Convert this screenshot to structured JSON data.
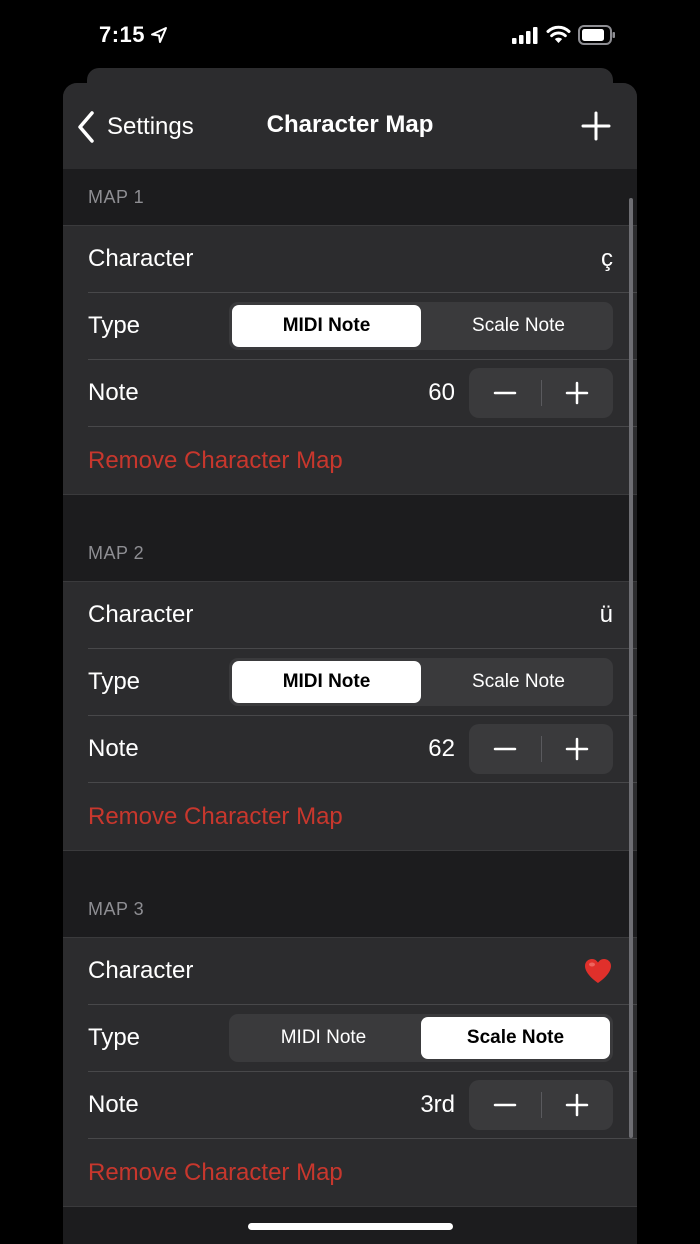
{
  "status": {
    "time": "7:15"
  },
  "nav": {
    "back_label": "Settings",
    "title": "Character Map"
  },
  "maps": [
    {
      "header": "MAP 1",
      "character_label": "Character",
      "character": "ç",
      "type_label": "Type",
      "segments": [
        "MIDI Note",
        "Scale Note"
      ],
      "selected_segment": "MIDI Note",
      "note_label": "Note",
      "note_value": "60",
      "remove_label": "Remove Character Map"
    },
    {
      "header": "MAP 2",
      "character_label": "Character",
      "character": "ü",
      "type_label": "Type",
      "segments": [
        "MIDI Note",
        "Scale Note"
      ],
      "selected_segment": "MIDI Note",
      "note_label": "Note",
      "note_value": "62",
      "remove_label": "Remove Character Map"
    },
    {
      "header": "MAP 3",
      "character_label": "Character",
      "character_icon": "heart-icon",
      "type_label": "Type",
      "segments": [
        "MIDI Note",
        "Scale Note"
      ],
      "selected_segment": "Scale Note",
      "note_label": "Note",
      "note_value": "3rd",
      "remove_label": "Remove Character Map"
    }
  ],
  "colors": {
    "destructive": "#c8372d",
    "background": "#1c1c1e",
    "cell": "#2c2c2e",
    "heart": "#e0302b"
  }
}
